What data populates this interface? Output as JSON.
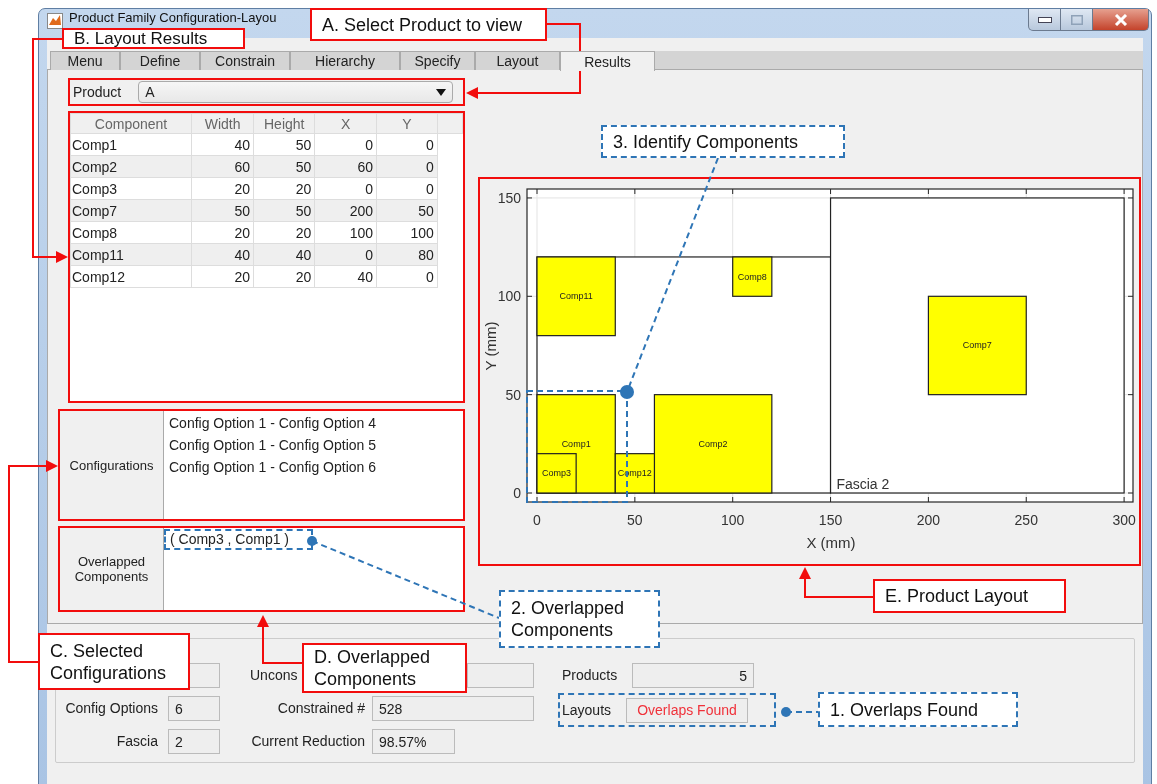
{
  "window": {
    "title": "Product Family Configuration-Layou"
  },
  "tabs": [
    {
      "label": "Menu",
      "selected": false
    },
    {
      "label": "Define",
      "selected": false
    },
    {
      "label": "Constrain",
      "selected": false
    },
    {
      "label": "Hierarchy",
      "selected": false
    },
    {
      "label": "Specify",
      "selected": false
    },
    {
      "label": "Layout",
      "selected": false
    },
    {
      "label": "Results",
      "selected": true
    }
  ],
  "product": {
    "label": "Product",
    "value": "A"
  },
  "table": {
    "columns": [
      "Component",
      "Width",
      "Height",
      "X",
      "Y"
    ],
    "rows": [
      [
        "Comp1",
        "40",
        "50",
        "0",
        "0"
      ],
      [
        "Comp2",
        "60",
        "50",
        "60",
        "0"
      ],
      [
        "Comp3",
        "20",
        "20",
        "0",
        "0"
      ],
      [
        "Comp7",
        "50",
        "50",
        "200",
        "50"
      ],
      [
        "Comp8",
        "20",
        "20",
        "100",
        "100"
      ],
      [
        "Comp11",
        "40",
        "40",
        "0",
        "80"
      ],
      [
        "Comp12",
        "20",
        "20",
        "40",
        "0"
      ]
    ]
  },
  "configurations": {
    "label": "Configurations",
    "items": [
      "Config Option 1 - Config Option 4",
      "Config Option 1 - Config Option 5",
      "Config Option 1 - Config Option 6"
    ]
  },
  "overlapped": {
    "label": "Overlapped Components",
    "items": [
      "( Comp3 , Comp1 )"
    ]
  },
  "layout_plot": {
    "xlabel": "X (mm)",
    "ylabel": "Y (mm)",
    "xticks": [
      "0",
      "50",
      "100",
      "150",
      "200",
      "250",
      "300"
    ],
    "yticks": [
      "150",
      "100",
      "50",
      "0"
    ],
    "fascia_label": "Fascia 2",
    "boxes": [
      {
        "label": "Comp1"
      },
      {
        "label": "Comp2"
      },
      {
        "label": "Comp3"
      },
      {
        "label": "Comp7"
      },
      {
        "label": "Comp8"
      },
      {
        "label": "Comp11"
      },
      {
        "label": "Comp12"
      }
    ]
  },
  "statistics": {
    "column_1": [
      {
        "label": "Config Options",
        "value": "6"
      },
      {
        "label": "Fascia",
        "value": "2"
      }
    ],
    "column_2": [
      {
        "label": "Uncons"
      },
      {
        "label": "Constrained #",
        "value": "528"
      },
      {
        "label": "Current Reduction",
        "value": "98.57%"
      }
    ],
    "column_3": [
      {
        "label": "Products",
        "value": "5"
      },
      {
        "label": "Layouts",
        "value": "Overlaps Found",
        "alert": true
      }
    ]
  },
  "callouts": [
    {
      "text": "A. Select Product to view",
      "kind": "solid"
    },
    {
      "text": "B. Layout Results",
      "kind": "solid"
    },
    {
      "text": "C. Selected Configurations",
      "kind": "solid"
    },
    {
      "text": "D. Overlapped Components",
      "kind": "solid"
    },
    {
      "text": "E. Product Layout",
      "kind": "solid"
    },
    {
      "text": "1. Overlaps Found",
      "kind": "dashed"
    },
    {
      "text": "2. Overlapped Components",
      "kind": "dashed"
    },
    {
      "text": "3. Identify Components",
      "kind": "dashed"
    }
  ]
}
